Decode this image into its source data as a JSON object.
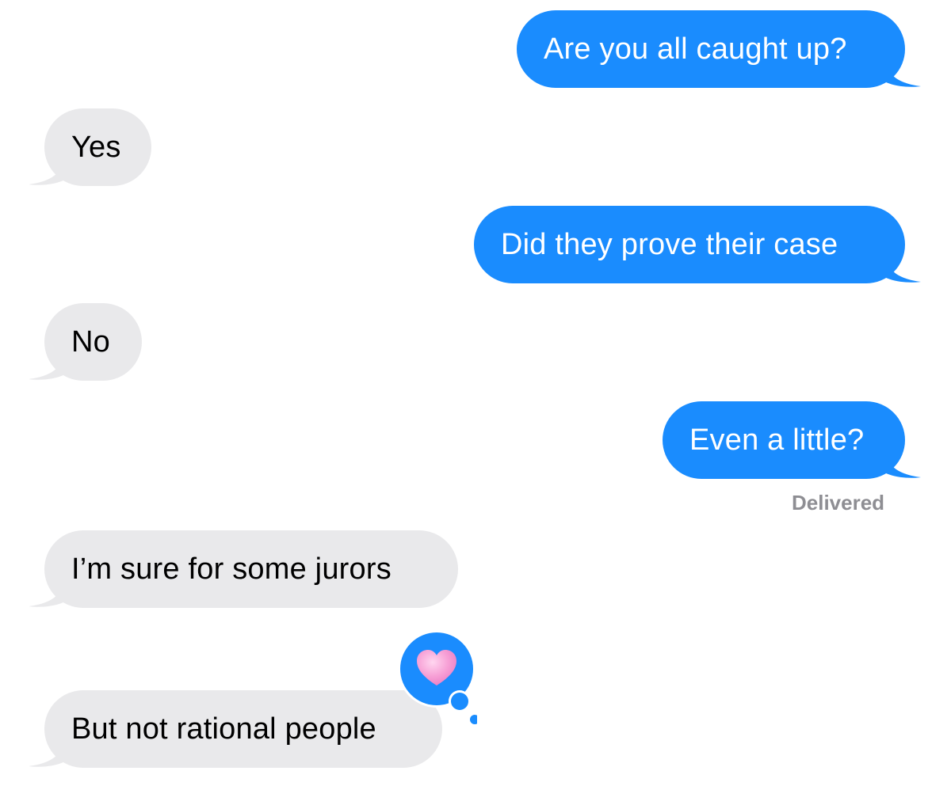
{
  "conversation": {
    "messages": [
      {
        "direction": "sent",
        "text": "Are you all caught up?"
      },
      {
        "direction": "received",
        "text": "Yes"
      },
      {
        "direction": "sent",
        "text": "Did they prove their case"
      },
      {
        "direction": "received",
        "text": "No"
      },
      {
        "direction": "sent",
        "text": "Even a little?"
      },
      {
        "direction": "received",
        "text": "I’m sure for some jurors"
      },
      {
        "direction": "received",
        "text": "But not rational people",
        "tapback": "heart-icon"
      }
    ],
    "delivery_status": "Delivered"
  },
  "colors": {
    "sent_bubble": "#1a8cfe",
    "received_bubble": "#e9e9eb",
    "status_text": "#8e8e93",
    "tapback_badge": "#1a8cfe",
    "heart": "#f7a1d6"
  }
}
